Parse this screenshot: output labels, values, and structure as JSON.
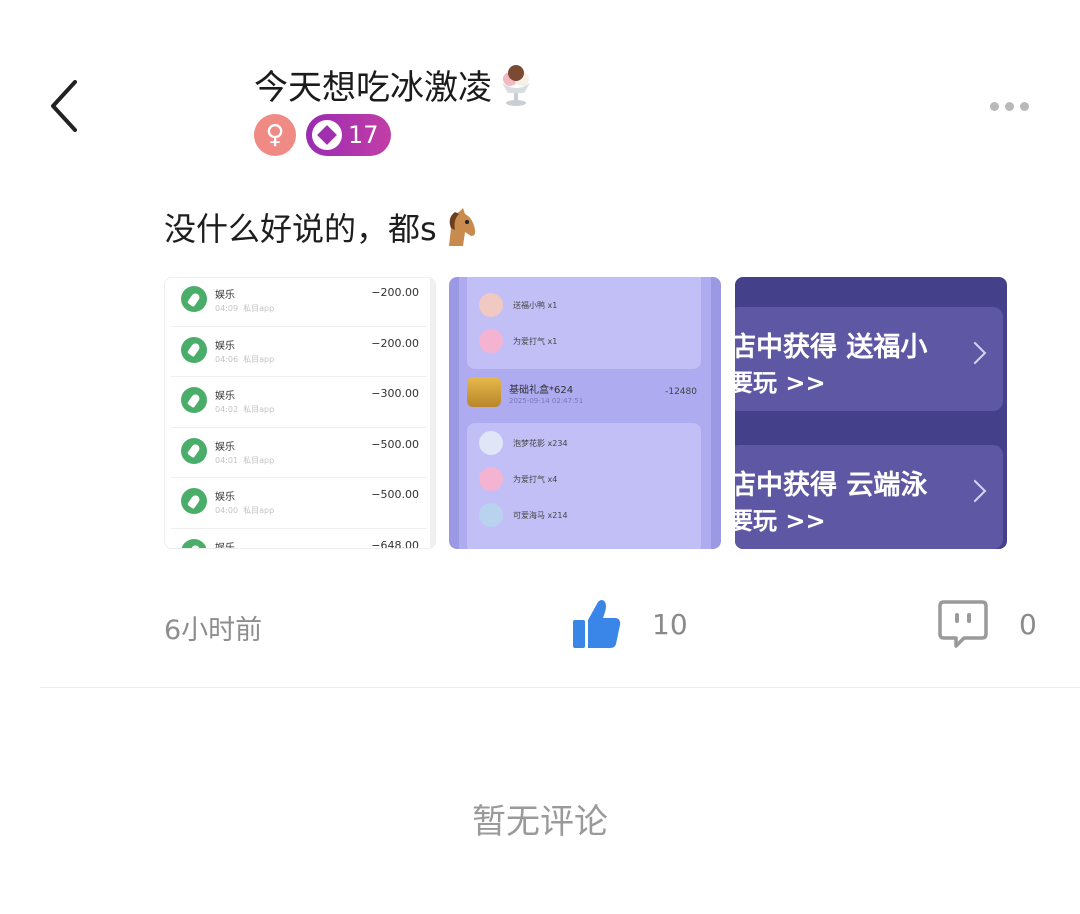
{
  "header": {
    "username": "今天想吃冰激凌",
    "gender_symbol": "♀",
    "level": "17"
  },
  "post": {
    "text": "没什么好说的，都s",
    "images": [
      {
        "transactions": [
          {
            "title": "娱乐",
            "time": "04:09",
            "source": "私目app",
            "amount": "−200.00"
          },
          {
            "title": "娱乐",
            "time": "04:06",
            "source": "私目app",
            "amount": "−200.00"
          },
          {
            "title": "娱乐",
            "time": "04:02",
            "source": "私目app",
            "amount": "−300.00"
          },
          {
            "title": "娱乐",
            "time": "04:01",
            "source": "私目app",
            "amount": "−500.00"
          },
          {
            "title": "娱乐",
            "time": "04:00",
            "source": "私目app",
            "amount": "−500.00"
          },
          {
            "title": "娱乐",
            "time": "",
            "source": "",
            "amount": "−648.00"
          }
        ]
      },
      {
        "gifts_top": [
          "送福小鸭 x1",
          "为爱打气 x1"
        ],
        "chest": {
          "title": "基础礼盒*624",
          "date": "2025-09-14 02:47:51",
          "amount": "-12480"
        },
        "gifts_bottom": [
          "泡梦花影 x234",
          "为爱打气 x4",
          "可爱海马 x214"
        ]
      },
      {
        "banners": [
          {
            "line1": "店中获得 送福小",
            "line2": "要玩 >>"
          },
          {
            "line1": "店中获得 云端泳",
            "line2": "要玩 >>"
          }
        ]
      }
    ],
    "time_ago": "6小时前",
    "like_count": "10",
    "comment_count": "0"
  },
  "comments": {
    "empty_text": "暂无评论"
  },
  "colors": {
    "accent_blue": "#3a86e8",
    "gender_pink": "#ef8a84",
    "level_purple": "#9a2bb2"
  }
}
